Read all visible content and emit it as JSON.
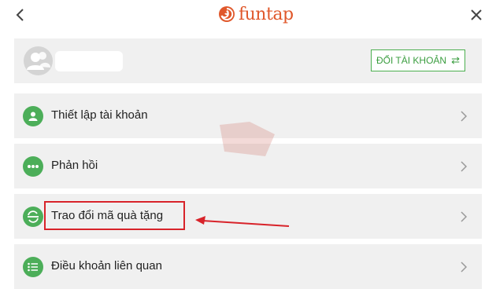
{
  "header": {
    "logo_text": "funtap",
    "back_icon": "chevron-left-icon",
    "close_icon": "close-icon"
  },
  "account": {
    "switch_label": "ĐỔI TÀI KHOẢN",
    "switch_icon": "swap-arrows-icon"
  },
  "menu": {
    "items": [
      {
        "label": "Thiết lập tài khoản",
        "icon": "user-icon"
      },
      {
        "label": "Phản hồi",
        "icon": "more-dots-icon"
      },
      {
        "label": "Trao đổi mã quà tặng",
        "icon": "exchange-icon"
      },
      {
        "label": "Điều khoản liên quan",
        "icon": "list-icon"
      }
    ]
  },
  "colors": {
    "accent_green": "#4cae59",
    "brand_orange": "#e0582b",
    "annotation_red": "#d8232a",
    "row_background": "#f0f0f0"
  }
}
